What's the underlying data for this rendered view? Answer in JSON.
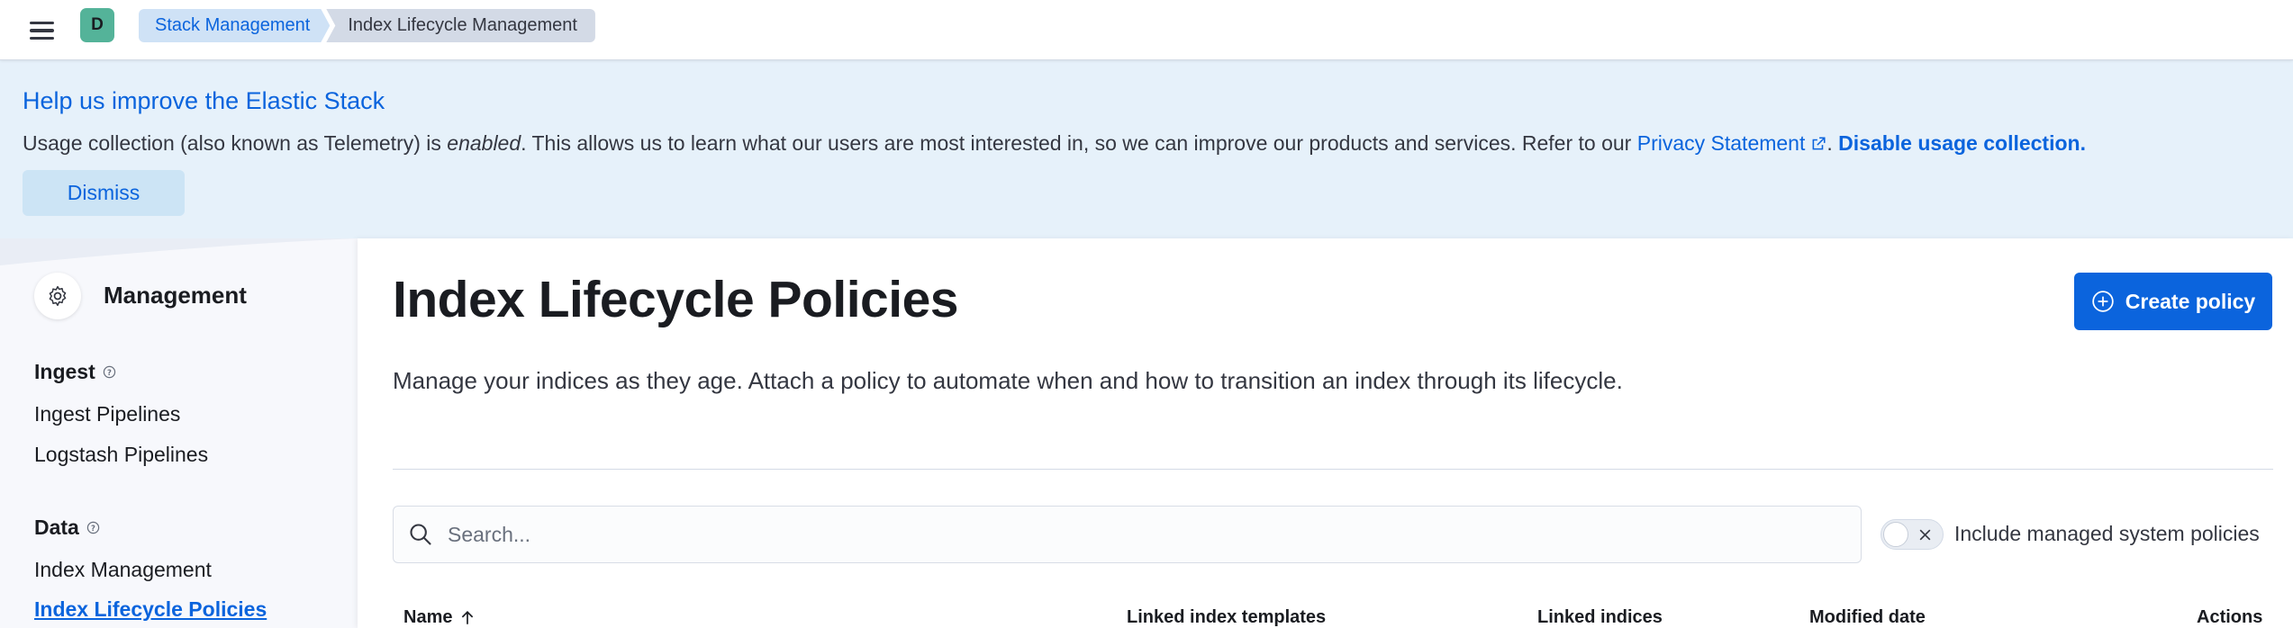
{
  "header": {
    "avatar_letter": "D",
    "breadcrumbs": [
      "Stack Management",
      "Index Lifecycle Management"
    ]
  },
  "callout": {
    "title": "Help us improve the Elastic Stack",
    "text_before": "Usage collection (also known as Telemetry) is ",
    "text_emphasis": "enabled",
    "text_after": ". This allows us to learn what our users are most interested in, so we can improve our products and services. Refer to our ",
    "privacy_link": "Privacy Statement",
    "separator": ". ",
    "disable_link": "Disable usage collection.",
    "dismiss_label": "Dismiss"
  },
  "sidenav": {
    "title": "Management",
    "groups": [
      {
        "label": "Ingest",
        "items": [
          "Ingest Pipelines",
          "Logstash Pipelines"
        ]
      },
      {
        "label": "Data",
        "items": [
          "Index Management",
          "Index Lifecycle Policies"
        ]
      }
    ],
    "active_item": "Index Lifecycle Policies"
  },
  "main": {
    "title": "Index Lifecycle Policies",
    "create_button": "Create policy",
    "description": "Manage your indices as they age. Attach a policy to automate when and how to transition an index through its lifecycle.",
    "search_placeholder": "Search...",
    "toggle_label": "Include managed system policies",
    "toggle_on": false,
    "columns": [
      "Name",
      "Linked index templates",
      "Linked indices",
      "Modified date",
      "Actions"
    ]
  },
  "colors": {
    "primary": "#0b64dd",
    "callout_bg": "#e6f1fa",
    "avatar": "#54b399"
  }
}
